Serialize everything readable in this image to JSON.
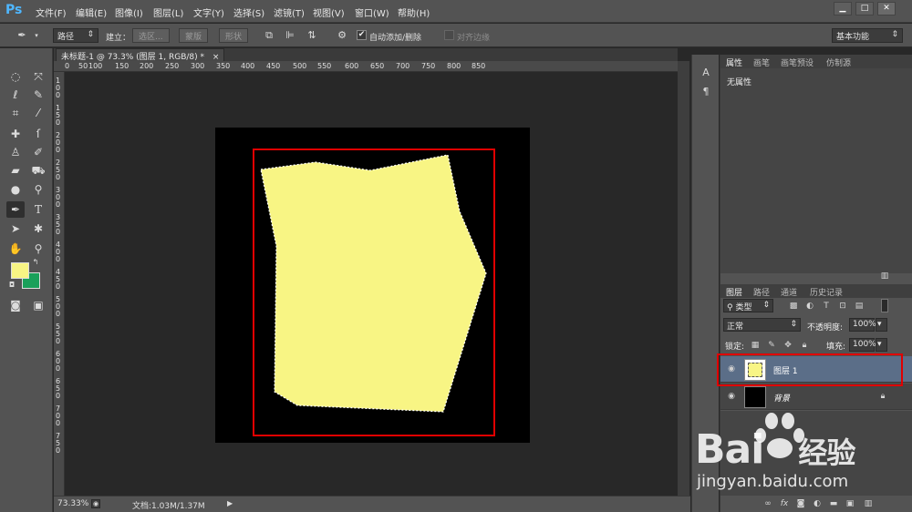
{
  "app": {
    "logo": "Ps"
  },
  "menu": [
    "文件(F)",
    "编辑(E)",
    "图像(I)",
    "图层(L)",
    "文字(Y)",
    "选择(S)",
    "滤镜(T)",
    "视图(V)",
    "窗口(W)",
    "帮助(H)"
  ],
  "window_controls": {
    "minimize": "▁",
    "maximize": "□",
    "close": "✕"
  },
  "options": {
    "mode": "路径",
    "create_label": "建立：",
    "selection_btn": "选区...",
    "mask_btn": "蒙版",
    "shape_btn": "形状",
    "auto_add_delete": "自动添加/删除",
    "auto_checked": "✔",
    "align_edges": "对齐边缘",
    "workspace": "基本功能"
  },
  "document": {
    "tab_title": "未标题-1 @ 73.3% (图层 1, RGB/8) *",
    "close": "×",
    "zoom": "73.33%",
    "doc_size": "文档:1.03M/1.37M",
    "shape_color": "#f8f584",
    "selection_border_color": "#e00000"
  },
  "ruler_top": [
    "0",
    "50",
    "100",
    "150",
    "200",
    "250",
    "300",
    "350",
    "400",
    "450",
    "500",
    "550",
    "600",
    "650",
    "700",
    "750",
    "800",
    "850"
  ],
  "ruler_left": [
    "1 0 0",
    "1 5 0",
    "2 0 0",
    "2 5 0",
    "3 0 0",
    "3 5 0",
    "4 0 0",
    "4 5 0",
    "5 0 0",
    "5 5 0",
    "6 0 0",
    "6 5 0",
    "7 0 0",
    "7 5 0"
  ],
  "colors": {
    "foreground": "#f8f584",
    "background": "#1aa05a"
  },
  "panels": {
    "properties_tabs": [
      "属性",
      "画笔",
      "画笔预设",
      "仿制源"
    ],
    "properties_text": "无属性",
    "layers_tabs": [
      "图层",
      "路径",
      "通道",
      "历史记录"
    ],
    "filter_kind": "类型",
    "blend_mode": "正常",
    "opacity_label": "不透明度:",
    "opacity_value": "100%",
    "lock_label": "锁定:",
    "fill_label": "填充:",
    "fill_value": "100%",
    "layers": [
      {
        "name": "图层 1",
        "selected": true
      },
      {
        "name": "背景",
        "selected": false
      }
    ]
  },
  "watermark": {
    "brand": "Bai",
    "brand_suffix": "经验",
    "url": "jingyan.baidu.com"
  }
}
